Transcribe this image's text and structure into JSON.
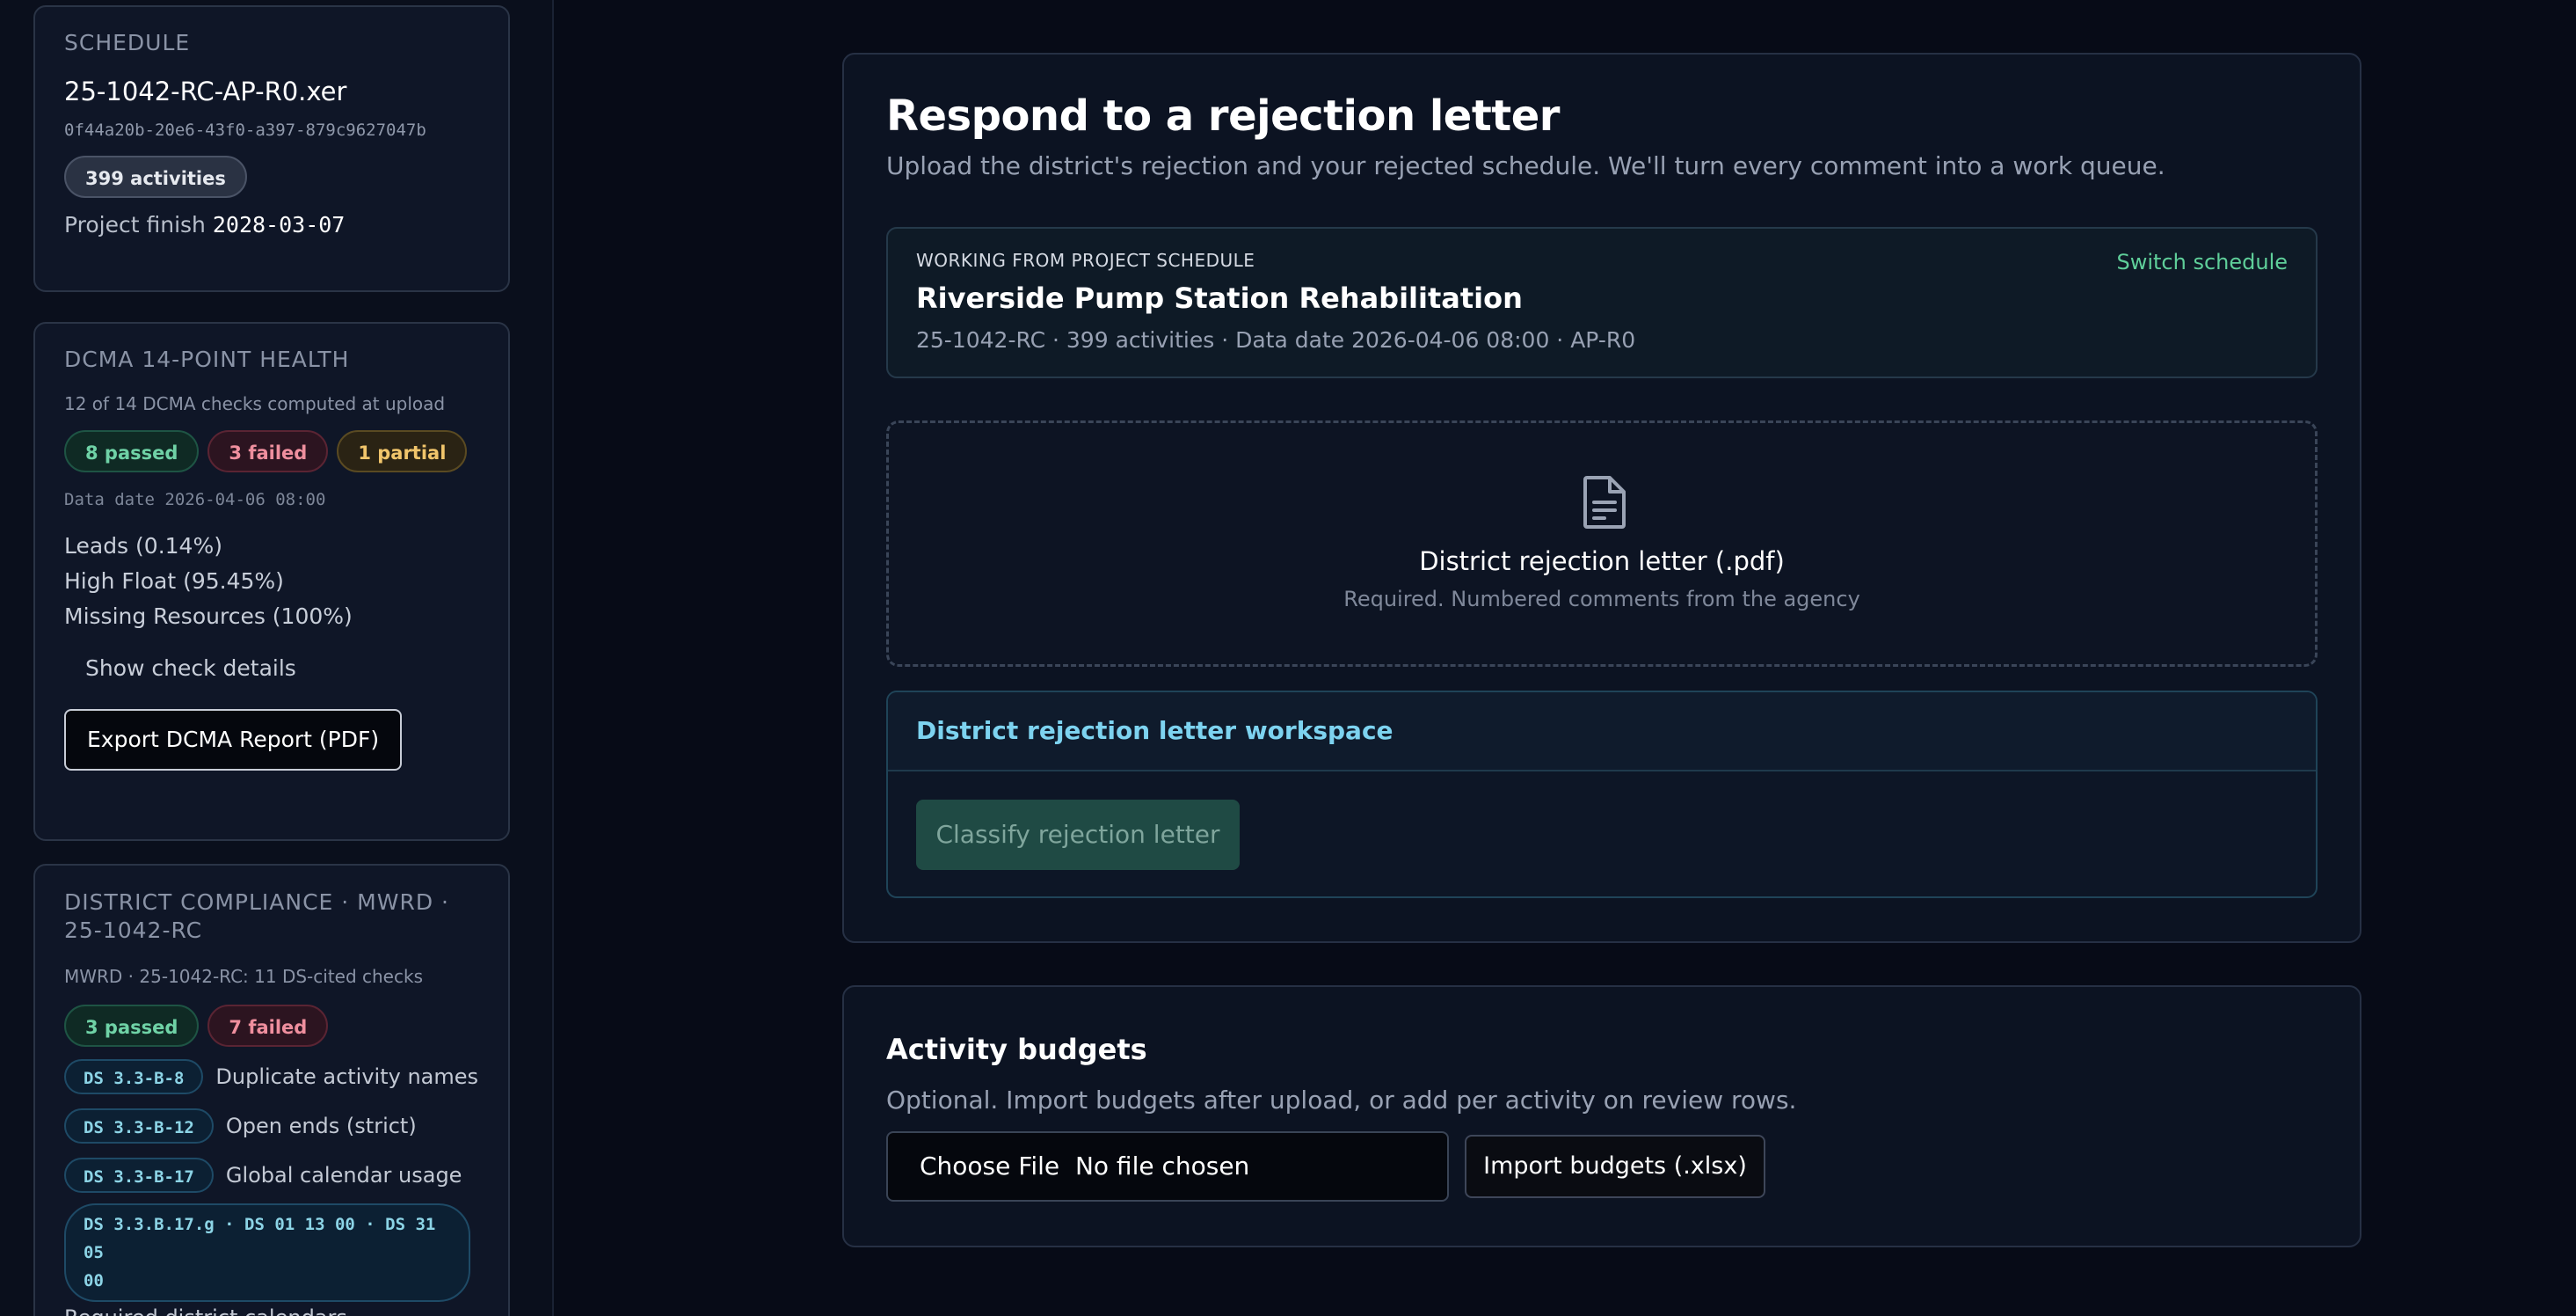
{
  "sidebar": {
    "schedule": {
      "title": "SCHEDULE",
      "filename": "25-1042-RC-AP-R0.xer",
      "hash": "0f44a20b-20e6-43f0-a397-879c9627047b",
      "activities_badge": "399 activities",
      "finish_label": "Project finish",
      "finish_value": "2028-03-07"
    },
    "dcma": {
      "title": "DCMA 14-POINT HEALTH",
      "computed": "12 of 14 DCMA checks computed at upload",
      "passed": "8 passed",
      "failed": "3 failed",
      "partial": "1 partial",
      "data_date": "Data date 2026-04-06 08:00",
      "failures": [
        "Leads (0.14%)",
        "High Float (95.45%)",
        "Missing Resources (100%)"
      ],
      "show_details": "Show check details",
      "export_label": "Export DCMA Report (PDF)"
    },
    "district": {
      "title": "DISTRICT COMPLIANCE · MWRD · 25-1042-RC",
      "summary": "MWRD · 25-1042-RC: 11 DS-cited checks",
      "passed": "3 passed",
      "failed": "7 failed",
      "checks": [
        {
          "code": "DS 3.3-B-8",
          "label": "Duplicate activity names"
        },
        {
          "code": "DS 3.3-B-12",
          "label": "Open ends (strict)"
        },
        {
          "code": "DS 3.3-B-17",
          "label": "Global calendar usage"
        }
      ],
      "multi_code_line1": "DS 3.3.B.17.g · DS 01 13 00 · DS 31 05",
      "multi_code_line2": "00",
      "multi_label": "Required district calendars"
    }
  },
  "main": {
    "title": "Respond to a rejection letter",
    "subtitle": "Upload the district's rejection and your rejected schedule. We'll turn every comment into a work queue.",
    "schedule_box": {
      "eyebrow": "WORKING FROM PROJECT SCHEDULE",
      "switch_label": "Switch schedule",
      "project_name": "Riverside Pump Station Rehabilitation",
      "meta": "25-1042-RC · 399 activities · Data date 2026-04-06 08:00 · AP-R0"
    },
    "dropzone": {
      "title": "District rejection letter (.pdf)",
      "hint": "Required. Numbered comments from the agency"
    },
    "workspace": {
      "title": "District rejection letter workspace",
      "classify_label": "Classify rejection letter"
    },
    "budgets": {
      "title": "Activity budgets",
      "description": "Optional. Import budgets after upload, or add per activity on review rows.",
      "choose_file": "Choose File",
      "no_file": "No file chosen",
      "import_label": "Import budgets (.xlsx)"
    }
  }
}
